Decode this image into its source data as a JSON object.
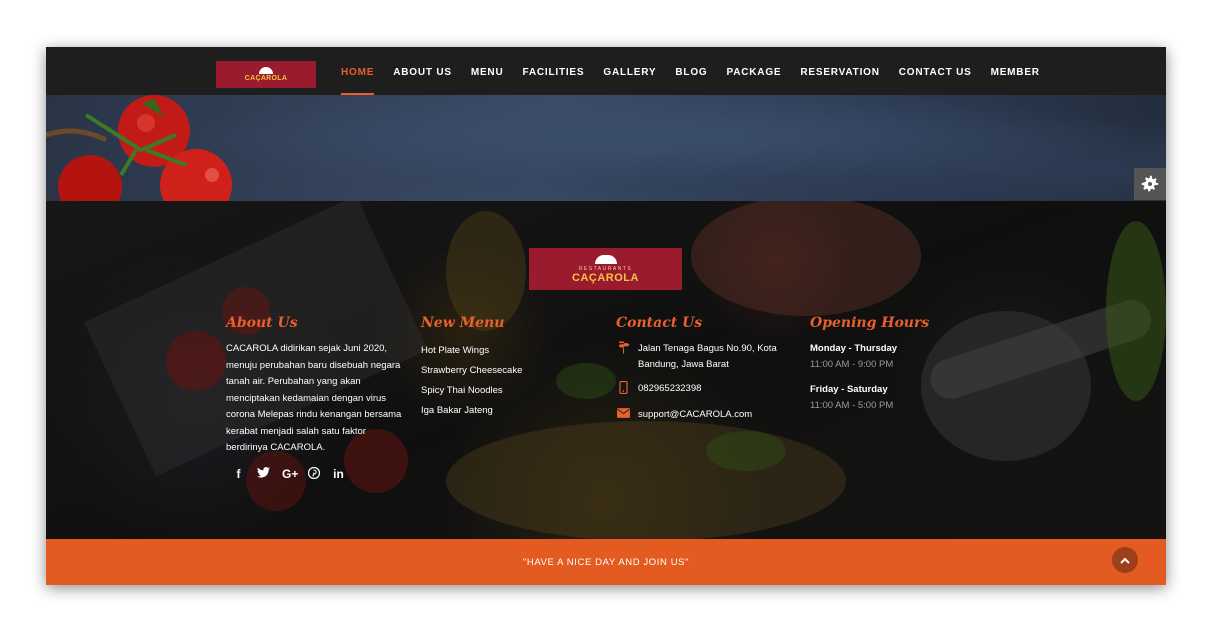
{
  "brand": {
    "logo_text": "CAÇAROLA",
    "logo_subtext": "RESTAURANTS"
  },
  "nav": {
    "items": [
      {
        "label": "HOME",
        "active": true
      },
      {
        "label": "ABOUT US"
      },
      {
        "label": "MENU"
      },
      {
        "label": "FACILITIES"
      },
      {
        "label": "GALLERY"
      },
      {
        "label": "BLOG"
      },
      {
        "label": "PACKAGE"
      },
      {
        "label": "RESERVATION"
      },
      {
        "label": "CONTACT US"
      },
      {
        "label": "MEMBER"
      }
    ]
  },
  "settings": {
    "icon": "gear-icon"
  },
  "footer": {
    "about": {
      "title": "About Us",
      "lines": [
        "CACAROLA didirikan sejak Juni 2020,",
        "menuju perubahan baru disebuah negara",
        "tanah air. Perubahan yang akan",
        "menciptakan kedamaian dengan virus",
        "corona Melepas rindu kenangan bersama",
        "kerabat menjadi salah satu faktor",
        "berdirinya CACAROLA."
      ],
      "social": [
        "f",
        "t",
        "G+",
        "p",
        "in"
      ]
    },
    "menu": {
      "title": "New Menu",
      "items": [
        "Hot Plate Wings",
        "Strawberry Cheesecake",
        "Spicy Thai Noodles",
        "Iga Bakar Jateng"
      ]
    },
    "contact": {
      "title": "Contact Us",
      "address_line1": "Jalan Tenaga Bagus No.90, Kota",
      "address_line2": "Bandung, Jawa Barat",
      "phone": "082965232398",
      "email": "support@CACAROLA.com"
    },
    "hours": {
      "title": "Opening Hours",
      "weekday_label": "Monday - Thursday",
      "weekday_value": "11:00 AM - 9:00 PM",
      "weekend_label": "Friday - Saturday",
      "weekend_value": "11:00 AM - 5:00 PM"
    }
  },
  "bottom_bar": {
    "message": "\"HAVE A NICE DAY AND JOIN US\""
  },
  "colors": {
    "accent": "#e8602c",
    "brand_red": "#9a1b2e",
    "bottom_bar": "#e35b20"
  }
}
